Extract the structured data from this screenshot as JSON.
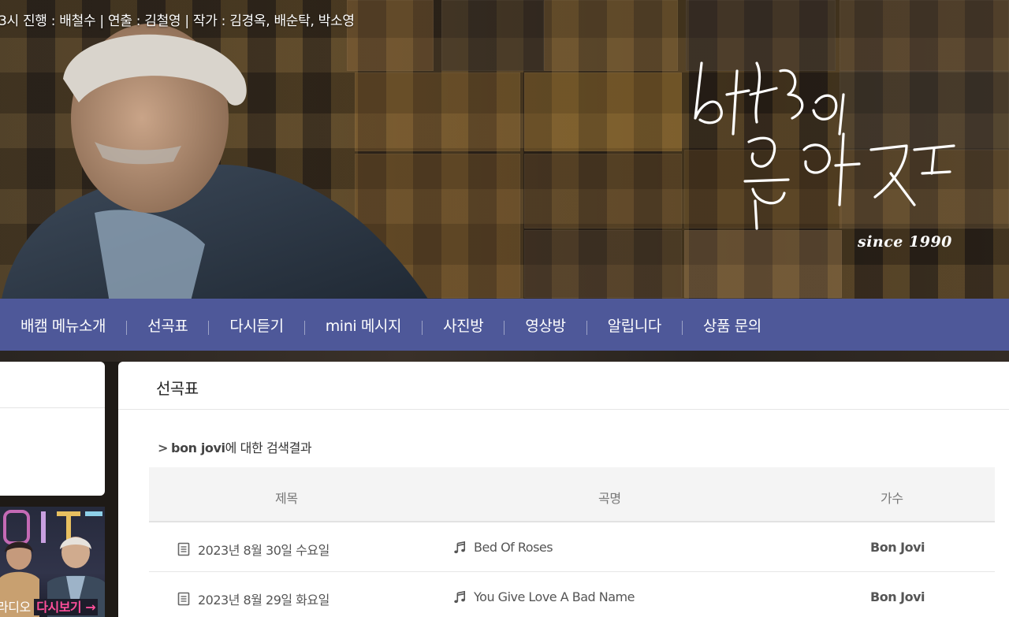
{
  "banner": {
    "credits": "3시   진행 : 배철수 | 연출 : 김철영 | 작가 : 김경옥, 배순탁, 박소영",
    "since": "since 1990"
  },
  "nav": {
    "items": [
      {
        "label": "배캠 메뉴소개"
      },
      {
        "label": "선곡표"
      },
      {
        "label": "다시듣기"
      },
      {
        "label": "mini 메시지"
      },
      {
        "label": "사진방"
      },
      {
        "label": "영상방"
      },
      {
        "label": "알립니다"
      },
      {
        "label": "상품 문의"
      }
    ]
  },
  "sidebar": {
    "promo_prefix": "라디오",
    "promo_highlight": "다시보기 →"
  },
  "main": {
    "title": "선곡표",
    "search": {
      "arrow": ">",
      "keyword": "bon jovi",
      "suffix": "에 대한 검색결과"
    },
    "table": {
      "headers": {
        "title": "제목",
        "song": "곡명",
        "artist": "가수"
      },
      "rows": [
        {
          "date": "2023년 8월 30일 수요일",
          "song": "Bed Of Roses",
          "artist": "Bon Jovi"
        },
        {
          "date": "2023년 8월 29일 화요일",
          "song": "You Give Love A Bad Name",
          "artist": "Bon Jovi"
        }
      ]
    }
  },
  "colors": {
    "nav_bg": "#4e5899",
    "promo_highlight": "#ff4f9a"
  }
}
